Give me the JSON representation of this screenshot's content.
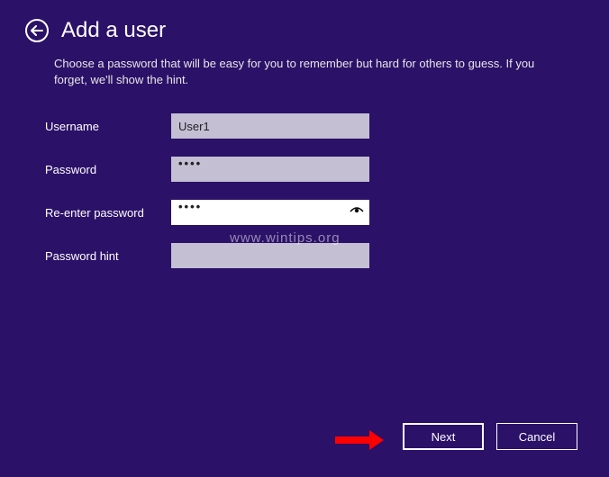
{
  "header": {
    "title": "Add a user"
  },
  "description": "Choose a password that will be easy for you to remember but hard for others to guess. If you forget, we'll show the hint.",
  "form": {
    "username": {
      "label": "Username",
      "value": "User1"
    },
    "password": {
      "label": "Password",
      "value": "••••"
    },
    "reenter": {
      "label": "Re-enter password",
      "value": "••••"
    },
    "hint": {
      "label": "Password hint",
      "value": ""
    }
  },
  "watermark": "www.wintips.org",
  "footer": {
    "next": "Next",
    "cancel": "Cancel"
  },
  "icons": {
    "back": "back-arrow-icon",
    "reveal": "eye-reveal-icon"
  }
}
